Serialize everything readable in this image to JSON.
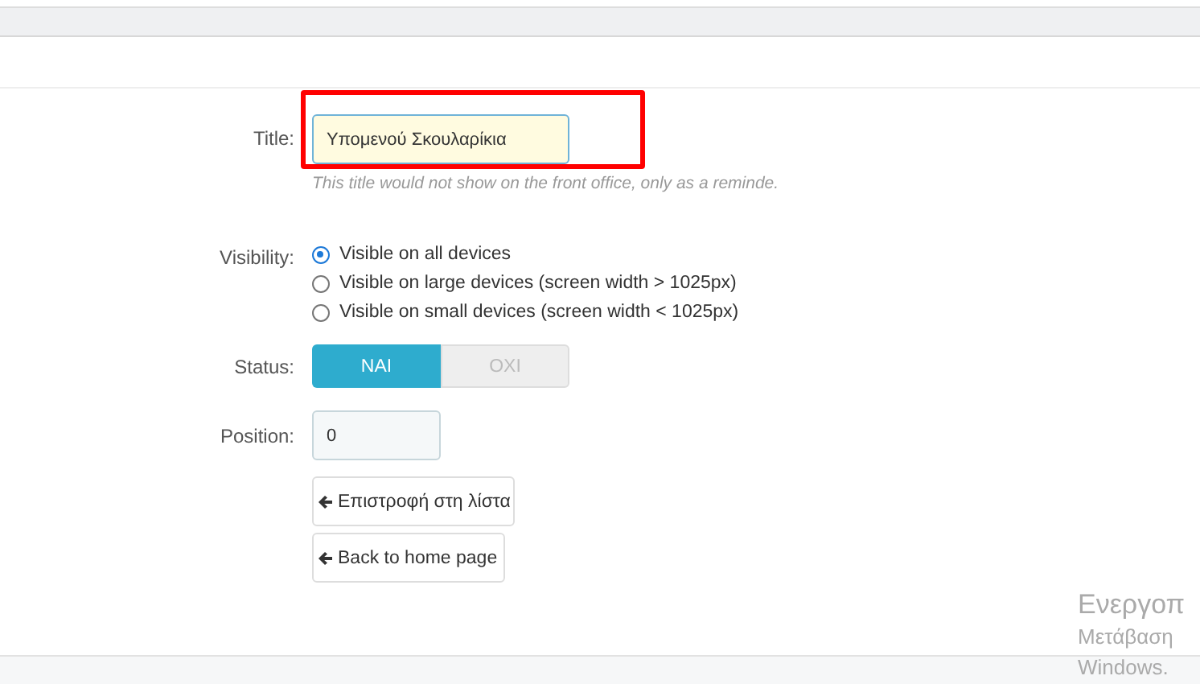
{
  "form": {
    "title_field": {
      "label": "Title:",
      "value": "Υπομενού Σκουλαρίκια",
      "highlighted": true,
      "help": "This title would not show on the front office, only as a reminde."
    },
    "visibility": {
      "label": "Visibility:",
      "options": [
        {
          "label": "Visible on all devices",
          "selected": true
        },
        {
          "label": "Visible on large devices (screen width > 1025px)",
          "selected": false
        },
        {
          "label": "Visible on small devices (screen width < 1025px)",
          "selected": false
        }
      ]
    },
    "status": {
      "label": "Status:",
      "options": [
        {
          "label": "ΝΑΙ",
          "selected": true
        },
        {
          "label": "ΟΧΙ",
          "selected": false
        }
      ]
    },
    "position": {
      "label": "Position:",
      "value": "0"
    },
    "buttons": [
      {
        "label": "Επιστροφή στη λίστα"
      },
      {
        "label": "Back to home page"
      }
    ]
  },
  "activation_notice": [
    "Ενεργοπ",
    "Μετάβαση",
    "Windows."
  ]
}
